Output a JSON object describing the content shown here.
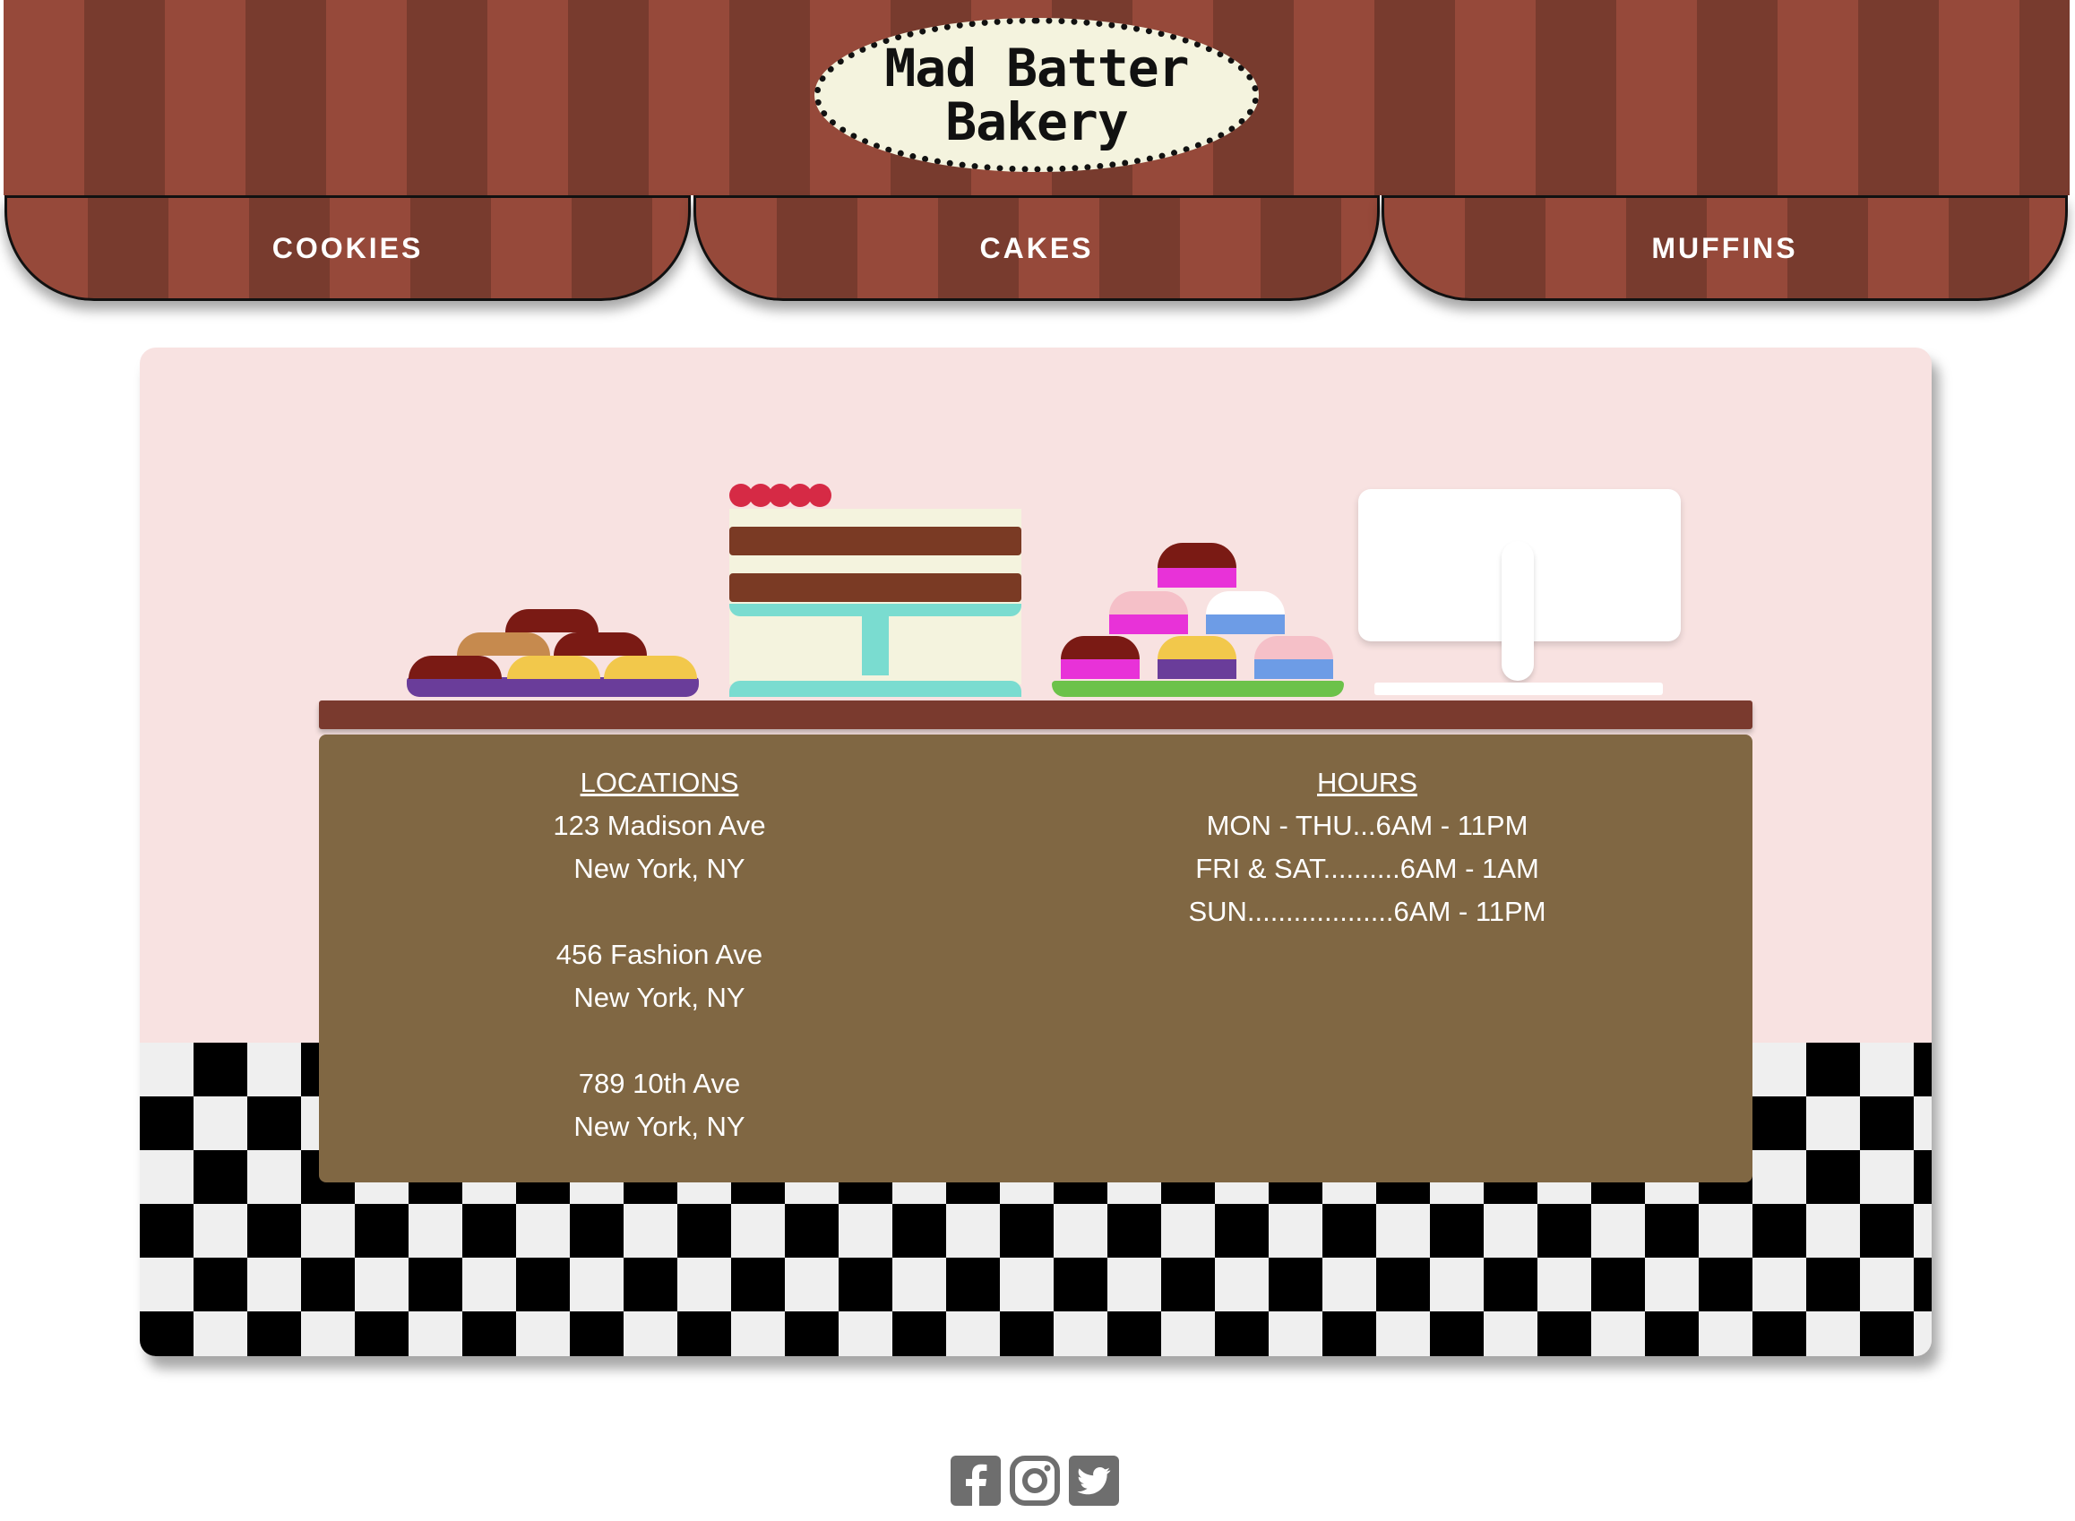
{
  "header": {
    "logo_line1": "Mad Batter",
    "logo_line2": "Bakery"
  },
  "nav": [
    {
      "label": "COOKIES"
    },
    {
      "label": "CAKES"
    },
    {
      "label": "MUFFINS"
    }
  ],
  "locations": {
    "heading": "LOCATIONS",
    "addresses": [
      {
        "street": "123 Madison Ave",
        "city": "New York, NY"
      },
      {
        "street": "456 Fashion Ave",
        "city": "New York, NY"
      },
      {
        "street": "789 10th Ave",
        "city": "New York, NY"
      }
    ]
  },
  "hours": {
    "heading": "HOURS",
    "rows": [
      "MON - THU...6AM - 11PM",
      "FRI & SAT..........6AM - 1AM",
      "SUN...................6AM - 11PM"
    ]
  },
  "social": [
    {
      "icon": "facebook-icon"
    },
    {
      "icon": "instagram-icon"
    },
    {
      "icon": "twitter-icon"
    }
  ],
  "colors": {
    "awning_light": "#96493a",
    "awning_dark": "#783b2e",
    "wall": "#f8e2e1",
    "counter": "#806743",
    "counter_top": "#7a3a2e"
  }
}
